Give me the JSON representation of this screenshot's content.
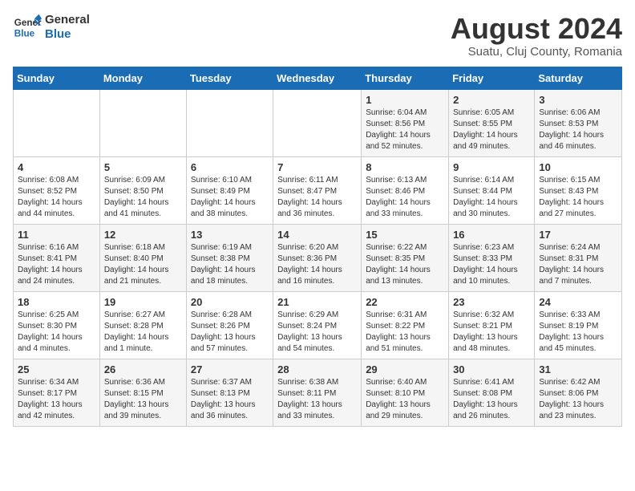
{
  "header": {
    "logo_line1": "General",
    "logo_line2": "Blue",
    "month": "August 2024",
    "location": "Suatu, Cluj County, Romania"
  },
  "weekdays": [
    "Sunday",
    "Monday",
    "Tuesday",
    "Wednesday",
    "Thursday",
    "Friday",
    "Saturday"
  ],
  "weeks": [
    [
      {
        "day": "",
        "info": ""
      },
      {
        "day": "",
        "info": ""
      },
      {
        "day": "",
        "info": ""
      },
      {
        "day": "",
        "info": ""
      },
      {
        "day": "1",
        "info": "Sunrise: 6:04 AM\nSunset: 8:56 PM\nDaylight: 14 hours\nand 52 minutes."
      },
      {
        "day": "2",
        "info": "Sunrise: 6:05 AM\nSunset: 8:55 PM\nDaylight: 14 hours\nand 49 minutes."
      },
      {
        "day": "3",
        "info": "Sunrise: 6:06 AM\nSunset: 8:53 PM\nDaylight: 14 hours\nand 46 minutes."
      }
    ],
    [
      {
        "day": "4",
        "info": "Sunrise: 6:08 AM\nSunset: 8:52 PM\nDaylight: 14 hours\nand 44 minutes."
      },
      {
        "day": "5",
        "info": "Sunrise: 6:09 AM\nSunset: 8:50 PM\nDaylight: 14 hours\nand 41 minutes."
      },
      {
        "day": "6",
        "info": "Sunrise: 6:10 AM\nSunset: 8:49 PM\nDaylight: 14 hours\nand 38 minutes."
      },
      {
        "day": "7",
        "info": "Sunrise: 6:11 AM\nSunset: 8:47 PM\nDaylight: 14 hours\nand 36 minutes."
      },
      {
        "day": "8",
        "info": "Sunrise: 6:13 AM\nSunset: 8:46 PM\nDaylight: 14 hours\nand 33 minutes."
      },
      {
        "day": "9",
        "info": "Sunrise: 6:14 AM\nSunset: 8:44 PM\nDaylight: 14 hours\nand 30 minutes."
      },
      {
        "day": "10",
        "info": "Sunrise: 6:15 AM\nSunset: 8:43 PM\nDaylight: 14 hours\nand 27 minutes."
      }
    ],
    [
      {
        "day": "11",
        "info": "Sunrise: 6:16 AM\nSunset: 8:41 PM\nDaylight: 14 hours\nand 24 minutes."
      },
      {
        "day": "12",
        "info": "Sunrise: 6:18 AM\nSunset: 8:40 PM\nDaylight: 14 hours\nand 21 minutes."
      },
      {
        "day": "13",
        "info": "Sunrise: 6:19 AM\nSunset: 8:38 PM\nDaylight: 14 hours\nand 18 minutes."
      },
      {
        "day": "14",
        "info": "Sunrise: 6:20 AM\nSunset: 8:36 PM\nDaylight: 14 hours\nand 16 minutes."
      },
      {
        "day": "15",
        "info": "Sunrise: 6:22 AM\nSunset: 8:35 PM\nDaylight: 14 hours\nand 13 minutes."
      },
      {
        "day": "16",
        "info": "Sunrise: 6:23 AM\nSunset: 8:33 PM\nDaylight: 14 hours\nand 10 minutes."
      },
      {
        "day": "17",
        "info": "Sunrise: 6:24 AM\nSunset: 8:31 PM\nDaylight: 14 hours\nand 7 minutes."
      }
    ],
    [
      {
        "day": "18",
        "info": "Sunrise: 6:25 AM\nSunset: 8:30 PM\nDaylight: 14 hours\nand 4 minutes."
      },
      {
        "day": "19",
        "info": "Sunrise: 6:27 AM\nSunset: 8:28 PM\nDaylight: 14 hours\nand 1 minute."
      },
      {
        "day": "20",
        "info": "Sunrise: 6:28 AM\nSunset: 8:26 PM\nDaylight: 13 hours\nand 57 minutes."
      },
      {
        "day": "21",
        "info": "Sunrise: 6:29 AM\nSunset: 8:24 PM\nDaylight: 13 hours\nand 54 minutes."
      },
      {
        "day": "22",
        "info": "Sunrise: 6:31 AM\nSunset: 8:22 PM\nDaylight: 13 hours\nand 51 minutes."
      },
      {
        "day": "23",
        "info": "Sunrise: 6:32 AM\nSunset: 8:21 PM\nDaylight: 13 hours\nand 48 minutes."
      },
      {
        "day": "24",
        "info": "Sunrise: 6:33 AM\nSunset: 8:19 PM\nDaylight: 13 hours\nand 45 minutes."
      }
    ],
    [
      {
        "day": "25",
        "info": "Sunrise: 6:34 AM\nSunset: 8:17 PM\nDaylight: 13 hours\nand 42 minutes."
      },
      {
        "day": "26",
        "info": "Sunrise: 6:36 AM\nSunset: 8:15 PM\nDaylight: 13 hours\nand 39 minutes."
      },
      {
        "day": "27",
        "info": "Sunrise: 6:37 AM\nSunset: 8:13 PM\nDaylight: 13 hours\nand 36 minutes."
      },
      {
        "day": "28",
        "info": "Sunrise: 6:38 AM\nSunset: 8:11 PM\nDaylight: 13 hours\nand 33 minutes."
      },
      {
        "day": "29",
        "info": "Sunrise: 6:40 AM\nSunset: 8:10 PM\nDaylight: 13 hours\nand 29 minutes."
      },
      {
        "day": "30",
        "info": "Sunrise: 6:41 AM\nSunset: 8:08 PM\nDaylight: 13 hours\nand 26 minutes."
      },
      {
        "day": "31",
        "info": "Sunrise: 6:42 AM\nSunset: 8:06 PM\nDaylight: 13 hours\nand 23 minutes."
      }
    ]
  ]
}
